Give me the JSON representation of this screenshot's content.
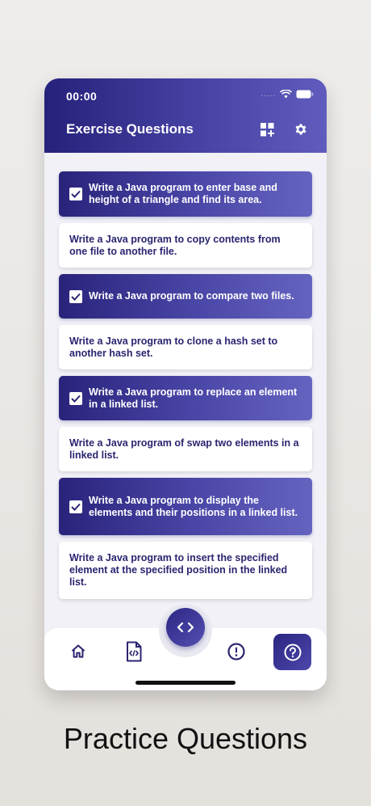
{
  "status": {
    "time": "00:00",
    "signal": "....."
  },
  "header": {
    "title": "Exercise Questions"
  },
  "items": [
    {
      "text": "Write a Java  program to enter base and height of a triangle and find its area.",
      "checked": true
    },
    {
      "text": "Write a Java  program to copy contents from one file to another file.",
      "checked": false
    },
    {
      "text": "Write a Java program to compare two files.",
      "checked": true
    },
    {
      "text": "Write a Java program to clone a hash set to another hash set.",
      "checked": false
    },
    {
      "text": "Write a Java program to replace an element in a linked list.",
      "checked": true
    },
    {
      "text": "Write a Java program of swap two elements in a linked list.",
      "checked": false
    },
    {
      "text": "Write a Java program to display the elements and their positions in a linked list.",
      "checked": true
    },
    {
      "text": "Write a Java program to insert the specified element at the specified position in the linked list.",
      "checked": false
    }
  ],
  "nav": {
    "icons": [
      "home-icon",
      "code-file-icon",
      "code-icon",
      "alert-icon",
      "help-icon"
    ],
    "active": "help-icon"
  },
  "colors": {
    "primary_dark": "#26217a",
    "primary_light": "#6563c0",
    "background": "#f1f1f7"
  },
  "caption": "Practice Questions"
}
